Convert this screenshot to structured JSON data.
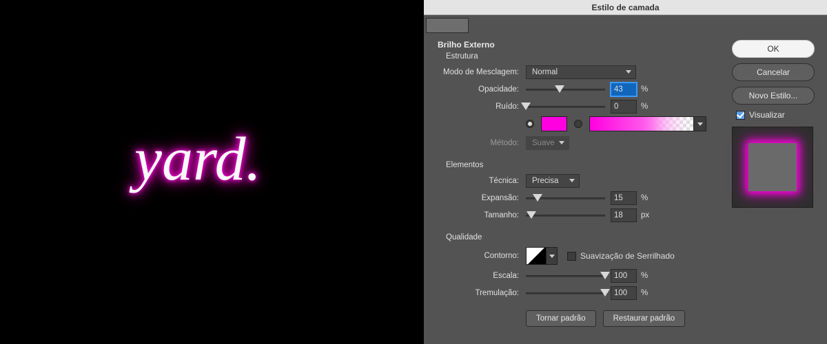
{
  "canvas": {
    "text": "yard."
  },
  "dialog": {
    "title": "Estilo de camada",
    "effect_title": "Brilho Externo",
    "sections": {
      "structure": {
        "title": "Estrutura",
        "blend": {
          "label": "Modo de Mesclagem:",
          "value": "Normal"
        },
        "opacity": {
          "label": "Opacidade:",
          "value": "43",
          "unit": "%",
          "pct": 43
        },
        "noise": {
          "label": "Ruído:",
          "value": "0",
          "unit": "%",
          "pct": 0
        },
        "color": {
          "solid": "#ff00e0",
          "selected": "solid"
        },
        "method": {
          "label": "Método:",
          "value": "Suave"
        }
      },
      "elements": {
        "title": "Elementos",
        "technique": {
          "label": "Técnica:",
          "value": "Precisa"
        },
        "spread": {
          "label": "Expansão:",
          "value": "15",
          "unit": "%",
          "pct": 15
        },
        "size": {
          "label": "Tamanho:",
          "value": "18",
          "unit": "px",
          "pct": 7
        }
      },
      "quality": {
        "title": "Qualidade",
        "contour": {
          "label": "Contorno:"
        },
        "antialias": {
          "label": "Suavização de Serrilhado",
          "checked": false
        },
        "range": {
          "label": "Escala:",
          "value": "100",
          "unit": "%",
          "pct": 100
        },
        "jitter": {
          "label": "Tremulação:",
          "value": "100",
          "unit": "%",
          "pct": 100
        }
      }
    },
    "footer": {
      "make_default": "Tornar padrão",
      "reset_default": "Restaurar padrão"
    }
  },
  "side": {
    "ok": "OK",
    "cancel": "Cancelar",
    "new_style": "Novo Estilo...",
    "preview": {
      "label": "Visualizar",
      "checked": true
    }
  }
}
